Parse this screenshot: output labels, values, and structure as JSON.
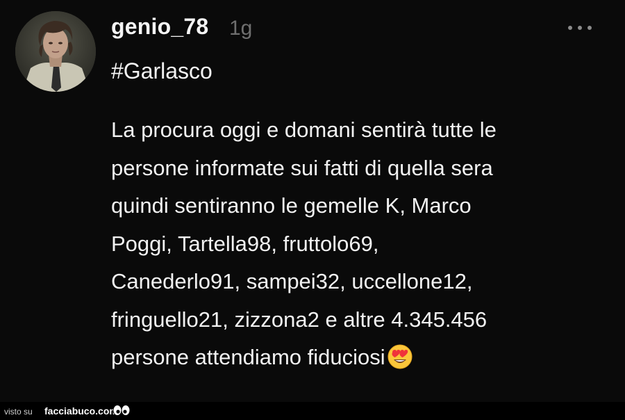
{
  "post": {
    "username": "genio_78",
    "timestamp": "1g",
    "hashtag": "#Garlasco",
    "body_lines": [
      "La procura oggi e domani sentirà tutte le",
      "persone informate sui fatti di quella sera",
      "quindi sentiranno le gemelle K, Marco",
      "Poggi, Tartella98, fruttolo69,",
      "Canederlo91, sampei32, uccellone12,",
      "fringuello21, zizzona2 e altre 4.345.456",
      "persone attendiamo fiduciosi"
    ],
    "trailing_emoji": "heart-eyes-emoji",
    "more_icon": "more-dots-icon"
  },
  "footer": {
    "visto_label": "visto su",
    "site_label": "facciabuco.com",
    "site_icon": "eyes-icon"
  },
  "colors": {
    "background": "#0a0a0a",
    "text": "#f2f2f2",
    "timestamp": "#6f6f6f"
  }
}
